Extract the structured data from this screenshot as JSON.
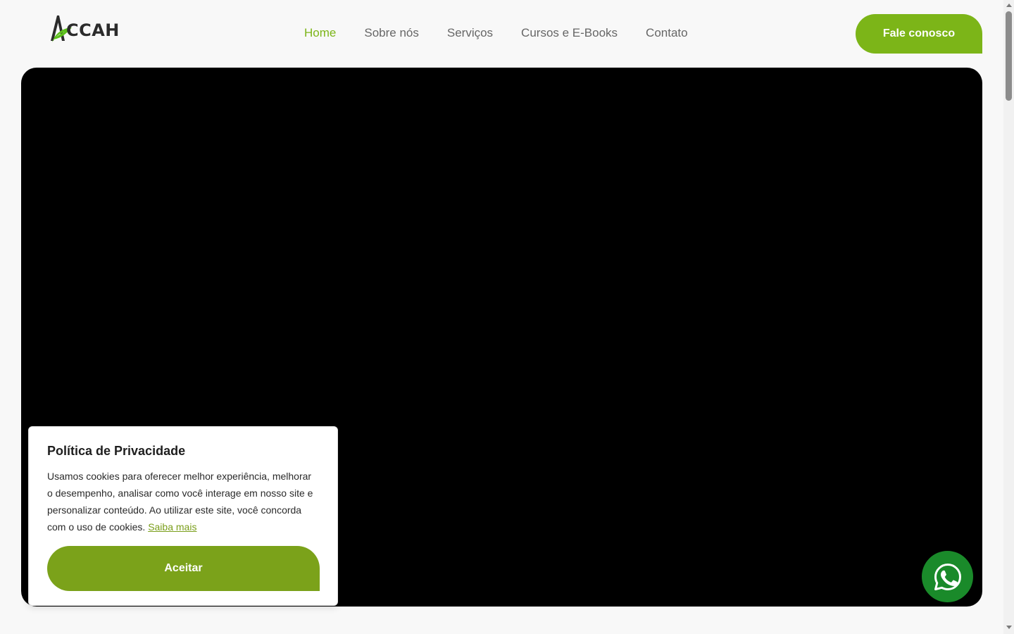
{
  "header": {
    "logo_text": "CCAH",
    "logo_alt": "ACCAH",
    "nav": [
      {
        "label": "Home",
        "active": true
      },
      {
        "label": "Sobre nós",
        "active": false
      },
      {
        "label": "Serviços",
        "active": false
      },
      {
        "label": "Cursos e E-Books",
        "active": false
      },
      {
        "label": "Contato",
        "active": false
      }
    ],
    "cta_label": "Fale conosco"
  },
  "cookie": {
    "title": "Política de Privacidade",
    "text": "Usamos cookies para oferecer melhor experiência, melhorar o desempenho, analisar como você interage em nosso site e personalizar conteúdo. Ao utilizar este site, você concorda com o uso de cookies.",
    "link_label": "Saiba mais",
    "accept_label": "Aceitar"
  },
  "icons": {
    "logo": "leaf-a-logo-icon",
    "whatsapp": "whatsapp-icon"
  },
  "colors": {
    "brand_green": "#7cb518",
    "accept_green": "#7ba21a",
    "whatsapp_green": "#1a8a2a",
    "nav_text": "#666666",
    "hero_bg": "#000000"
  }
}
